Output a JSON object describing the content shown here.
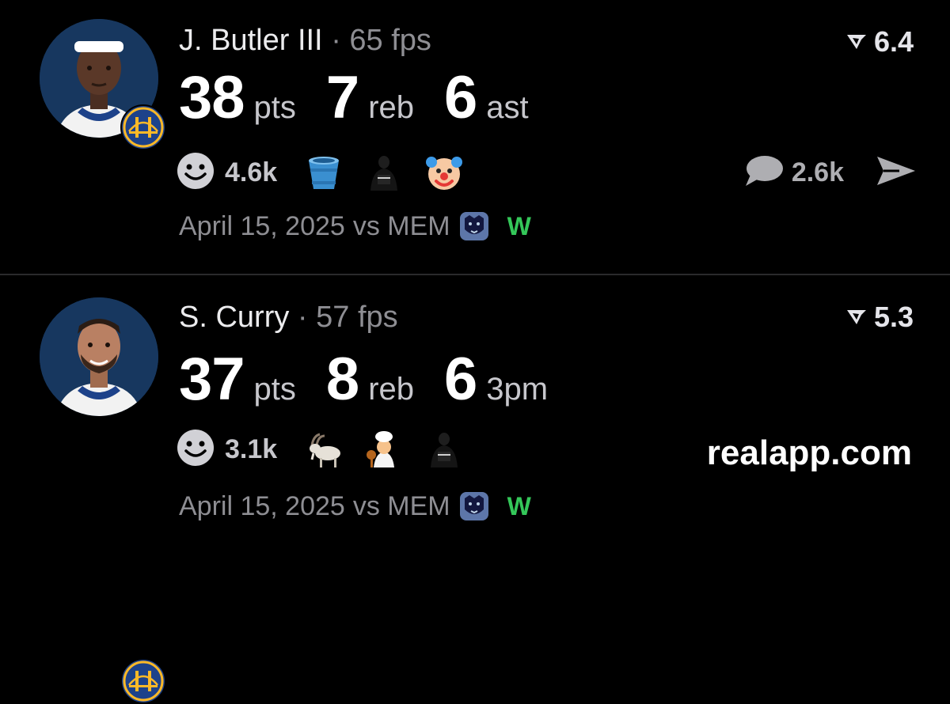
{
  "posts": [
    {
      "player_name": "J. Butler III",
      "separator": "·",
      "fps": "65 fps",
      "rating": "6.4",
      "stats": [
        {
          "value": "38",
          "unit": "pts"
        },
        {
          "value": "7",
          "unit": "reb"
        },
        {
          "value": "6",
          "unit": "ast"
        }
      ],
      "reaction_count": "4.6k",
      "reaction_emojis": [
        "bucket-emoji",
        "nets-player-emoji",
        "clown-emoji"
      ],
      "comment_count": "2.6k",
      "date": "April 15, 2025",
      "opponent": "vs MEM",
      "result": "W"
    },
    {
      "player_name": "S. Curry",
      "separator": "·",
      "fps": "57 fps",
      "rating": "5.3",
      "stats": [
        {
          "value": "37",
          "unit": "pts"
        },
        {
          "value": "8",
          "unit": "reb"
        },
        {
          "value": "6",
          "unit": "3pm"
        }
      ],
      "reaction_count": "3.1k",
      "reaction_emojis": [
        "goat-emoji",
        "chef-emoji",
        "nets-player-emoji"
      ],
      "brand": "realapp.com",
      "date": "April 15, 2025",
      "opponent": "vs MEM",
      "result": "W"
    }
  ],
  "colors": {
    "background": "#000000",
    "win_green": "#34c759",
    "secondary_text": "#8e8e93",
    "team_blue": "#1d428a",
    "team_gold": "#fdb927"
  }
}
